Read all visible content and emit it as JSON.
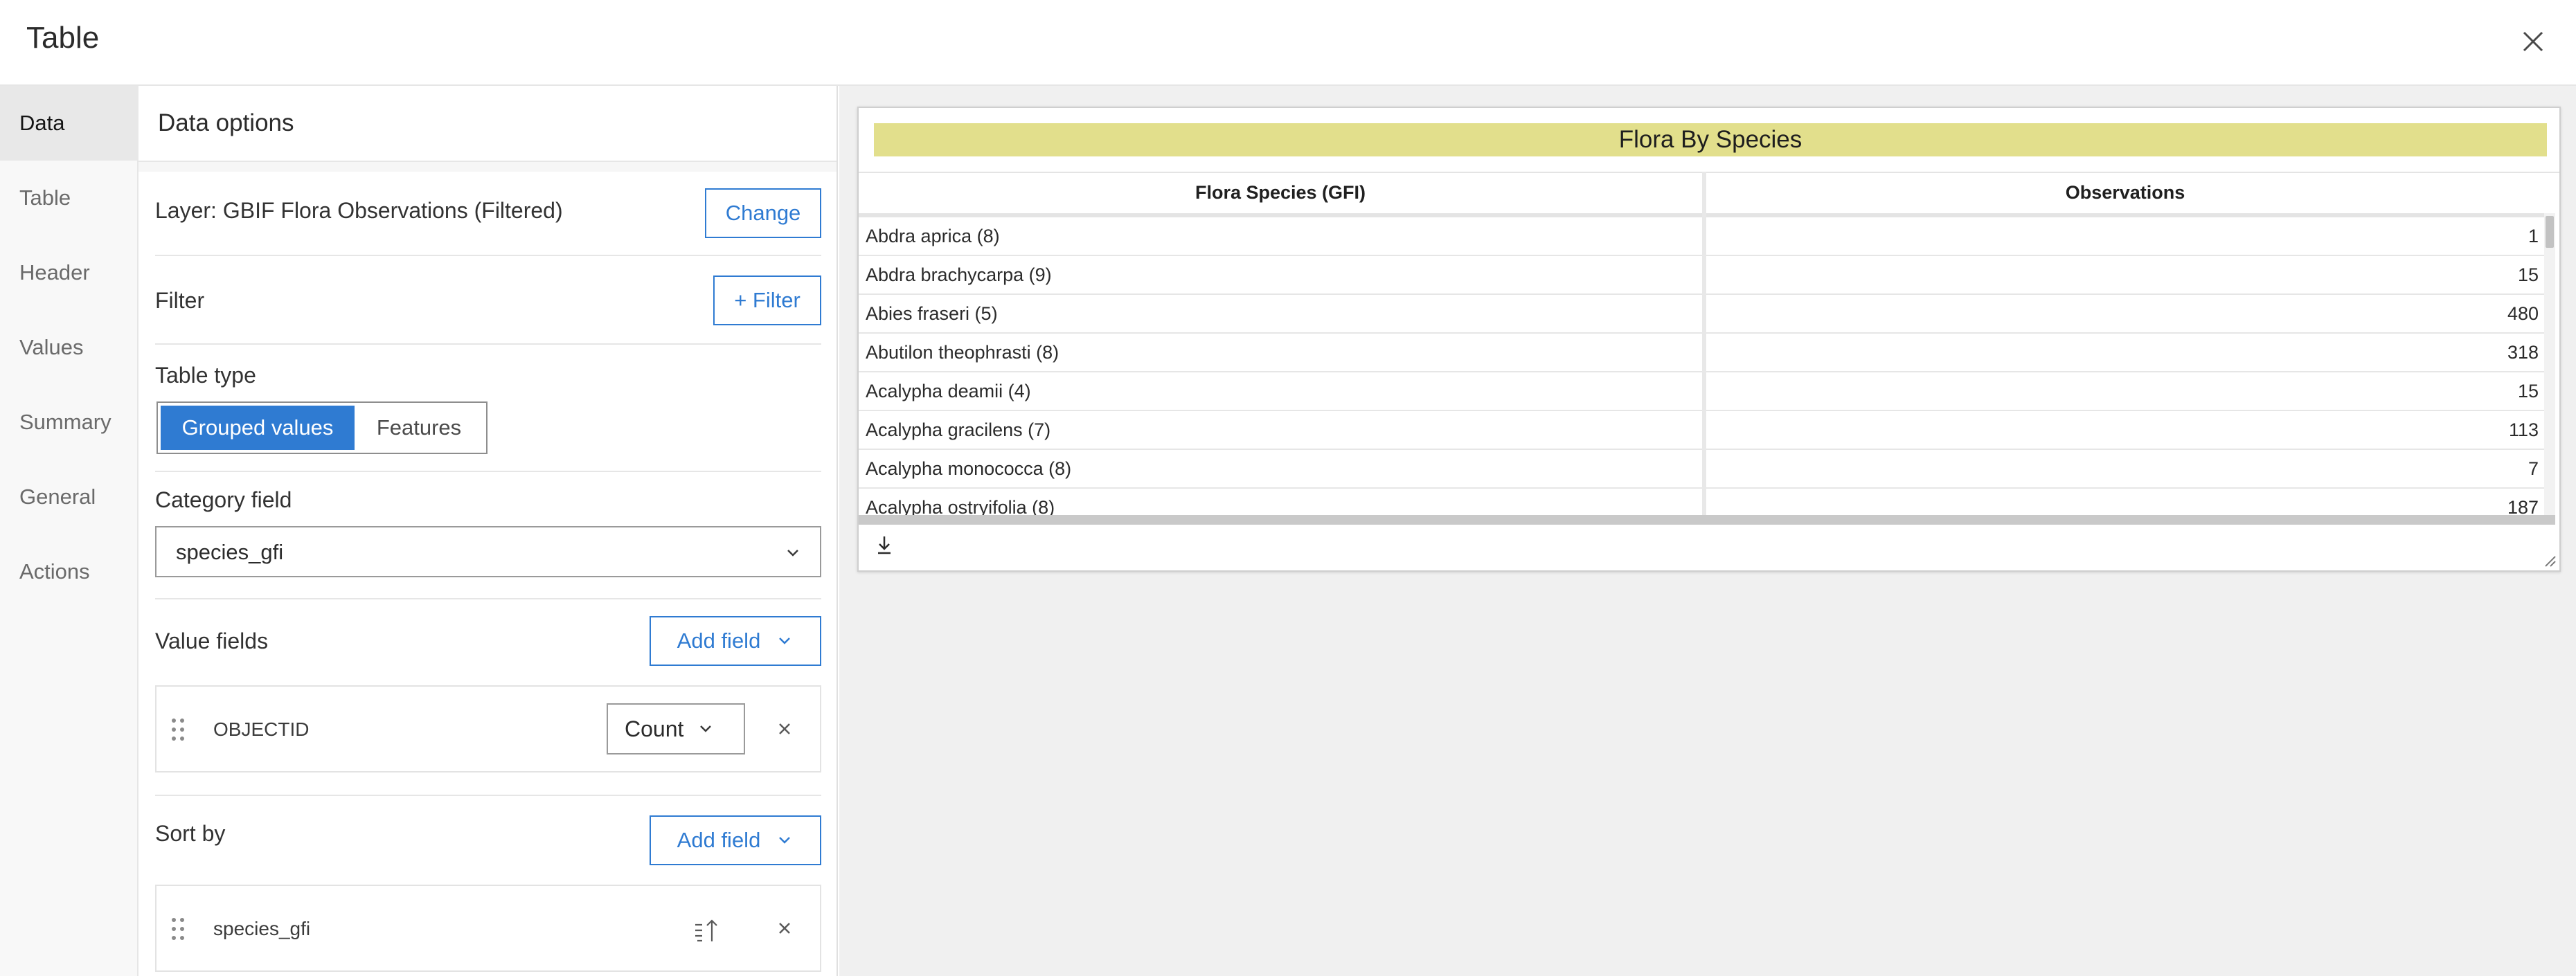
{
  "header": {
    "title": "Table"
  },
  "nav": {
    "items": [
      {
        "label": "Data",
        "active": true
      },
      {
        "label": "Table",
        "active": false
      },
      {
        "label": "Header",
        "active": false
      },
      {
        "label": "Values",
        "active": false
      },
      {
        "label": "Summary",
        "active": false
      },
      {
        "label": "General",
        "active": false
      },
      {
        "label": "Actions",
        "active": false
      }
    ]
  },
  "data_options": {
    "title": "Data options",
    "layer_label": "Layer: GBIF Flora Observations (Filtered)",
    "change_button": "Change",
    "filter_label": "Filter",
    "filter_button": "+ Filter",
    "table_type_label": "Table type",
    "table_type_options": [
      "Grouped values",
      "Features"
    ],
    "table_type_selected": "Grouped values",
    "category_field_label": "Category field",
    "category_field_value": "species_gfi",
    "value_fields_label": "Value fields",
    "add_field_button": "Add field",
    "value_field": {
      "name": "OBJECTID",
      "statistic": "Count"
    },
    "sort_by_label": "Sort by",
    "sort_add_field_button": "Add field",
    "sort_field": {
      "name": "species_gfi"
    }
  },
  "preview": {
    "table_title": "Flora By Species",
    "columns": [
      "Flora Species (GFI)",
      "Observations"
    ],
    "rows": [
      {
        "species": "Abdra aprica (8)",
        "observations": "1"
      },
      {
        "species": "Abdra brachycarpa (9)",
        "observations": "15"
      },
      {
        "species": "Abies fraseri (5)",
        "observations": "480"
      },
      {
        "species": "Abutilon theophrasti (8)",
        "observations": "318"
      },
      {
        "species": "Acalypha deamii (4)",
        "observations": "15"
      },
      {
        "species": "Acalypha gracilens (7)",
        "observations": "113"
      },
      {
        "species": "Acalypha monococca (8)",
        "observations": "7"
      },
      {
        "species": "Acalypha ostryifolia (8)",
        "observations": "187"
      }
    ]
  },
  "colors": {
    "accent": "#2f7bd2",
    "title_bar": "#e2df8c",
    "nav_active": "#e8e8e8"
  }
}
